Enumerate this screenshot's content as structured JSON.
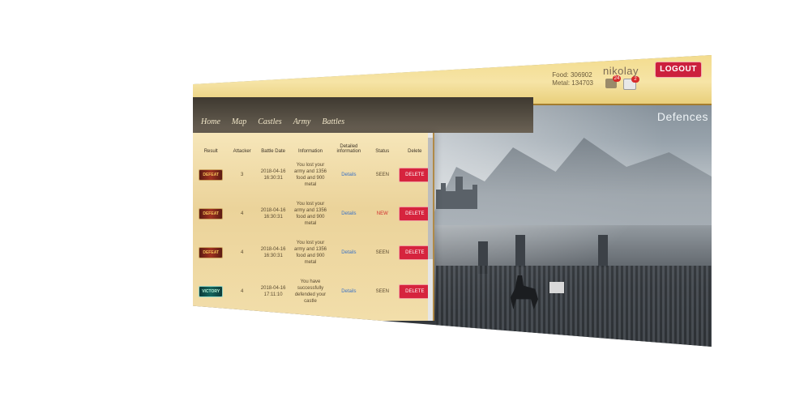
{
  "header": {
    "food_label": "Food: 306902",
    "metal_label": "Metal: 134703",
    "username": "nikolay",
    "notif_badge_1": "24",
    "notif_badge_2": "2",
    "logout_label": "LOGOUT"
  },
  "nav": {
    "items": [
      "Home",
      "Map",
      "Castles",
      "Army",
      "Battles"
    ]
  },
  "page": {
    "title": "Defences"
  },
  "table": {
    "columns": [
      "Result",
      "Attacker",
      "Battle Date",
      "Information",
      "Detailed information",
      "Status",
      "Delete"
    ],
    "rows": [
      {
        "result": "DEFEAT",
        "attacker": "3",
        "date": "2018-04-16 16:30:31",
        "information": "You lost your army and 1356 food and 900 metal",
        "details": "Details",
        "status": "SEEN",
        "delete": "DELETE"
      },
      {
        "result": "DEFEAT",
        "attacker": "4",
        "date": "2018-04-16 16:30:31",
        "information": "You lost your army and 1356 food and 900 metal",
        "details": "Details",
        "status": "NEW",
        "delete": "DELETE"
      },
      {
        "result": "DEFEAT",
        "attacker": "4",
        "date": "2018-04-16 16:30:31",
        "information": "You lost your army and 1356 food and 900 metal",
        "details": "Details",
        "status": "SEEN",
        "delete": "DELETE"
      },
      {
        "result": "VICTORY",
        "attacker": "4",
        "date": "2018-04-16 17:11:10",
        "information": "You have successfully defended your castle",
        "details": "Details",
        "status": "SEEN",
        "delete": "DELETE"
      }
    ]
  },
  "colors": {
    "logout": "#cc1f3d",
    "delete": "#d6243e",
    "status_new": "#d12f2f",
    "details_link": "#3b72c4"
  }
}
